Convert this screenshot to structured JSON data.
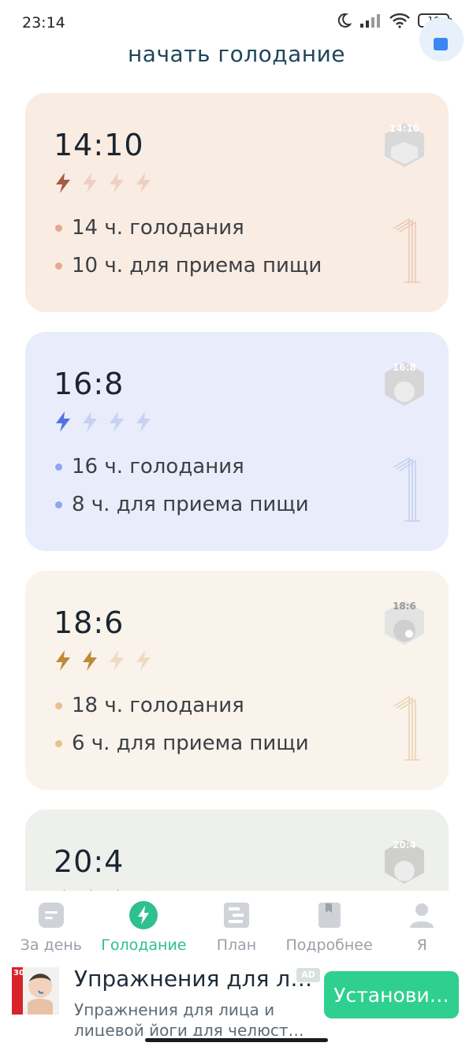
{
  "status_bar": {
    "time": "23:14",
    "battery": "10",
    "icons": [
      "moon-icon",
      "signal-icon",
      "wifi-icon",
      "battery-icon"
    ]
  },
  "header": {
    "title": "начать голодание"
  },
  "plans": [
    {
      "ratio": "14:10",
      "badge": "14:10",
      "intensity": 1,
      "max_intensity": 4,
      "fasting": "14 ч. голодания",
      "eating": "10 ч. для приема пищи",
      "colors": {
        "bg": "#f9ece2",
        "accent": "#a75a45",
        "light": "#efcfc4",
        "dot": "#e5a994"
      }
    },
    {
      "ratio": "16:8",
      "badge": "16:8",
      "intensity": 1,
      "max_intensity": 4,
      "fasting": "16 ч. голодания",
      "eating": "8 ч. для приема пищи",
      "colors": {
        "bg": "#e9edfb",
        "accent": "#4f72e2",
        "light": "#c6d1f3",
        "dot": "#8ea7ee"
      }
    },
    {
      "ratio": "18:6",
      "badge": "18:6",
      "intensity": 2,
      "max_intensity": 4,
      "fasting": "18 ч. голодания",
      "eating": "6 ч. для приема пищи",
      "colors": {
        "bg": "#f9f3ec",
        "accent": "#be8a36",
        "light": "#efdcc0",
        "dot": "#e7c28e"
      }
    },
    {
      "ratio": "20:4",
      "badge": "20:4",
      "intensity": 3,
      "max_intensity": 4,
      "colors": {
        "bg": "#eef0ec",
        "accent": "#6aa46a",
        "light": "#c9dcc6",
        "dot": "#9cc79a"
      }
    }
  ],
  "bottom_nav": {
    "items": [
      {
        "label": "За день",
        "icon": "day-icon",
        "active": false
      },
      {
        "label": "Голодание",
        "icon": "fasting-bolt-icon",
        "active": true
      },
      {
        "label": "План",
        "icon": "plan-icon",
        "active": false
      },
      {
        "label": "Подробнее",
        "icon": "bookmark-icon",
        "active": false
      },
      {
        "label": "Я",
        "icon": "profile-icon",
        "active": false
      }
    ],
    "active_color": "#2fc08f",
    "inactive_color": "#9aa1a9"
  },
  "ad": {
    "title": "Упражнения для л…",
    "badge": "AD",
    "description": "Упражнения для лица и лицевой йоги для челюст…",
    "install_label": "Установи…",
    "thumb_label": "30",
    "button_color": "#2fd08f"
  }
}
